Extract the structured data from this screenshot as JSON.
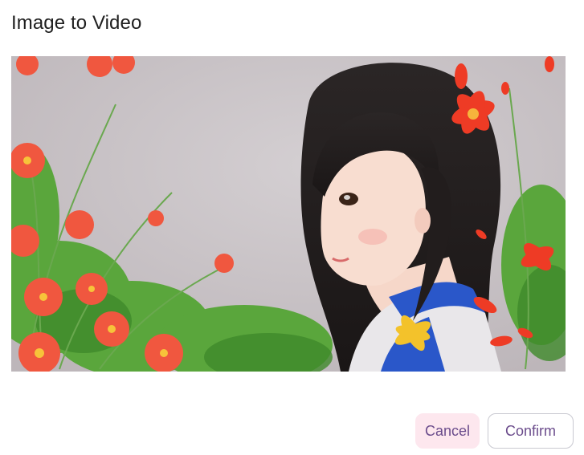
{
  "dialog": {
    "title": "Image to Video"
  },
  "preview": {
    "image_description_icon": "anime-girl-with-red-flowers-illustration"
  },
  "actions": {
    "cancel_label": "Cancel",
    "confirm_label": "Confirm"
  },
  "colors": {
    "accent_text": "#6b4c8c",
    "cancel_bg": "#fde7ee",
    "confirm_border": "#c9c9d1"
  }
}
